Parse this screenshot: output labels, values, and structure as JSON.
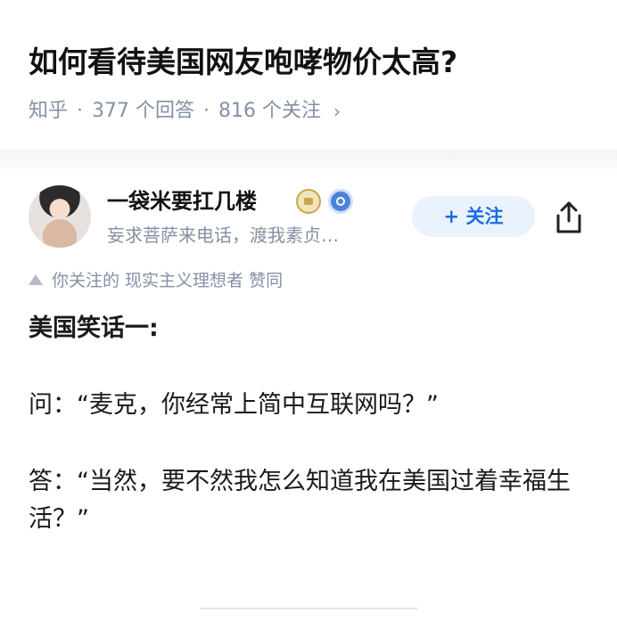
{
  "question": {
    "title": "如何看待美国网友咆哮物价太高?",
    "source": "知乎",
    "answers": "377 个回答",
    "followers": "816 个关注",
    "chevron": "›"
  },
  "author": {
    "name": "一袋米要扛几楼",
    "bio": "妄求菩萨来电话，渡我素贞…",
    "badges": [
      "gold-crown-badge",
      "blue-verified-badge"
    ],
    "follow_label": "+ 关注"
  },
  "endorsement": {
    "text": "你关注的 现实主义理想者 赞同"
  },
  "answer": {
    "heading": "美国笑话一:",
    "q_line": "问：“麦克，你经常上简中互联网吗？”",
    "a_line": "答：“当然，要不然我怎么知道我在美国过着幸福生活？”"
  },
  "colors": {
    "meta_gray": "#8590a6",
    "follow_blue": "#1a6ee0",
    "follow_bg": "#eaf2fe"
  },
  "icons": {
    "share": "share-icon",
    "triangle": "upvote-triangle-icon"
  }
}
